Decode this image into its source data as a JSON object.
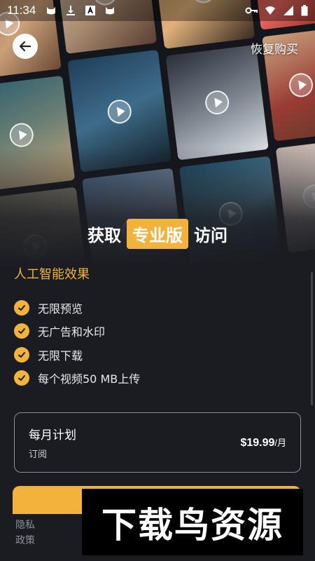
{
  "status_bar": {
    "time": "11:34",
    "left_icons": [
      "cat-icon",
      "download-icon",
      "text-a-icon",
      "cat-icon"
    ],
    "right_icons": [
      "key-icon",
      "wifi-icon",
      "signal-icon",
      "battery-icon"
    ]
  },
  "header": {
    "back_icon": "arrow-left-icon",
    "restore_label": "恢复购买"
  },
  "headline": {
    "prefix": "获取",
    "badge": "专业版",
    "suffix": "访问"
  },
  "features": {
    "title": "人工智能效果",
    "items": [
      {
        "label": "无限预览"
      },
      {
        "label": "无广告和水印"
      },
      {
        "label": "无限下载"
      },
      {
        "label": "每个视频50 MB上传"
      }
    ]
  },
  "plan": {
    "name": "每月计划",
    "subtitle": "订阅",
    "price": "$19.99",
    "unit": "/月"
  },
  "footer": {
    "privacy_label": "隐私政策"
  },
  "watermark": {
    "text": "下载鸟资源"
  },
  "colors": {
    "accent": "#f3b23b",
    "background": "#1b1c22"
  }
}
